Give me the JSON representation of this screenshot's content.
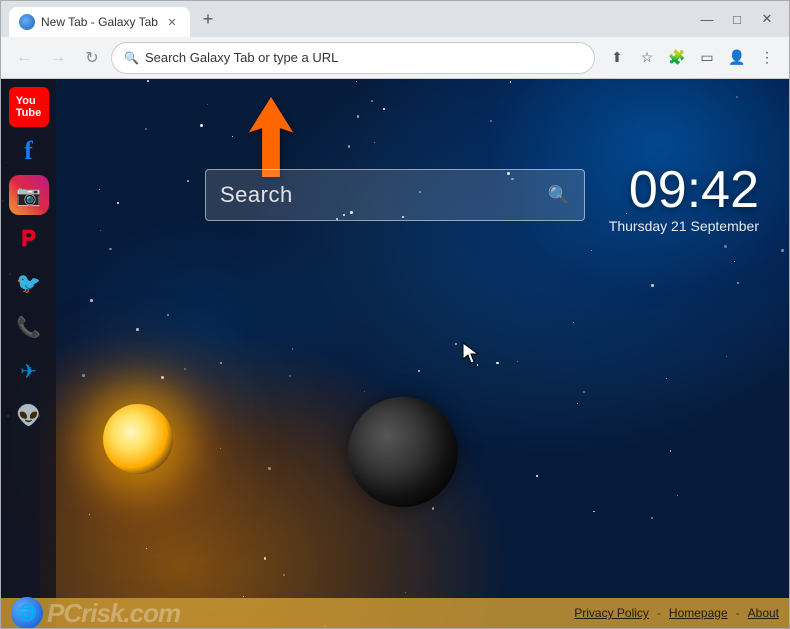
{
  "window": {
    "title": "New Tab - Galaxy Tab",
    "favicon_color": "#4488ff"
  },
  "addressbar": {
    "placeholder": "Search Galaxy Tab or type a URL",
    "back_label": "←",
    "forward_label": "→",
    "reload_label": "↻"
  },
  "sidebar": {
    "items": [
      {
        "id": "youtube",
        "label": "YouTube",
        "icon": "▶"
      },
      {
        "id": "facebook",
        "label": "Facebook",
        "icon": "f"
      },
      {
        "id": "instagram",
        "label": "Instagram",
        "icon": "📷"
      },
      {
        "id": "pinterest",
        "label": "Pinterest",
        "icon": "𝐏"
      },
      {
        "id": "twitter",
        "label": "Twitter",
        "icon": "🐦"
      },
      {
        "id": "whatsapp",
        "label": "WhatsApp",
        "icon": "📞"
      },
      {
        "id": "telegram",
        "label": "Telegram",
        "icon": "✈"
      },
      {
        "id": "reddit",
        "label": "Reddit",
        "icon": "👽"
      }
    ]
  },
  "search": {
    "placeholder": "Search",
    "icon": "🔍"
  },
  "clock": {
    "time": "09:42",
    "date": "Thursday 21 September"
  },
  "footer": {
    "privacy_policy": "Privacy Policy",
    "homepage": "Homepage",
    "separator": "-",
    "about": "About"
  },
  "toolbar": {
    "share_icon": "share",
    "bookmark_icon": "star",
    "extensions_icon": "puzzle",
    "profile_icon": "profile",
    "menu_icon": "menu"
  }
}
